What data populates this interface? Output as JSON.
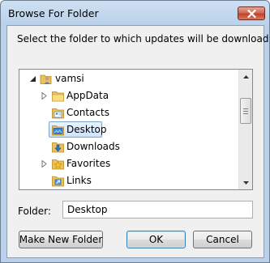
{
  "window": {
    "title": "Browse For Folder"
  },
  "instruction": "Select the folder to which updates will be downloaded.",
  "tree": {
    "items": [
      {
        "label": "vamsi",
        "icon": "user-folder-icon",
        "expander": "expanded",
        "level": 0
      },
      {
        "label": "AppData",
        "icon": "folder-icon",
        "expander": "collapsed",
        "level": 1
      },
      {
        "label": "Contacts",
        "icon": "contacts-folder-icon",
        "expander": "none",
        "level": 1
      },
      {
        "label": "Desktop",
        "icon": "desktop-folder-icon",
        "expander": "none",
        "level": 1,
        "selected": true
      },
      {
        "label": "Downloads",
        "icon": "downloads-folder-icon",
        "expander": "none",
        "level": 1
      },
      {
        "label": "Favorites",
        "icon": "favorites-folder-icon",
        "expander": "collapsed",
        "level": 1
      },
      {
        "label": "Links",
        "icon": "links-folder-icon",
        "expander": "none",
        "level": 1
      }
    ]
  },
  "folder": {
    "label": "Folder:",
    "value": "Desktop"
  },
  "buttons": {
    "make_new_folder": "Make New Folder",
    "ok": "OK",
    "cancel": "Cancel"
  }
}
